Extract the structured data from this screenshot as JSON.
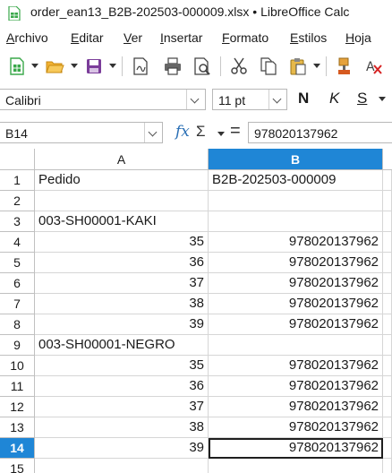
{
  "window": {
    "title": "order_ean13_B2B-202503-000009.xlsx • LibreOffice Calc"
  },
  "menu": {
    "items": [
      {
        "label": "Archivo",
        "u": "A",
        "rest": "rchivo"
      },
      {
        "label": "Editar",
        "u": "E",
        "rest": "ditar"
      },
      {
        "label": "Ver",
        "u": "V",
        "rest": "er"
      },
      {
        "label": "Insertar",
        "u": "I",
        "rest": "nsertar"
      },
      {
        "label": "Formato",
        "u": "F",
        "rest": "ormato"
      },
      {
        "label": "Estilos",
        "u": "E",
        "rest": "stilos"
      },
      {
        "label": "Hoja",
        "u": "H",
        "rest": "oja"
      }
    ]
  },
  "toolbar": {
    "icons": [
      "new-spreadsheet-icon",
      "open-folder-icon",
      "save-icon",
      "export-pdf-icon",
      "print-icon",
      "print-preview-icon",
      "cut-icon",
      "copy-icon",
      "paste-icon",
      "clone-formatting-icon",
      "clear-formatting-icon"
    ]
  },
  "format": {
    "font_name": "Calibri",
    "font_size": "11 pt",
    "bold": "N",
    "italic": "K",
    "underline": "S"
  },
  "formula_bar": {
    "name_box": "B14",
    "fx": "fx",
    "sum": "Σ",
    "equals": "=",
    "content": "978020137962"
  },
  "sheet": {
    "columns": [
      "A",
      "B"
    ],
    "selected_column": "B",
    "active_cell": "B14",
    "rows": [
      {
        "num": "1",
        "a": "Pedido",
        "b": "B2B-202503-000009",
        "a_num": false,
        "b_num": false
      },
      {
        "num": "2",
        "a": "",
        "b": "",
        "a_num": false,
        "b_num": false
      },
      {
        "num": "3",
        "a": "003-SH00001-KAKI",
        "b": "",
        "a_num": false,
        "b_num": false
      },
      {
        "num": "4",
        "a": "35",
        "b": "978020137962",
        "a_num": true,
        "b_num": true
      },
      {
        "num": "5",
        "a": "36",
        "b": "978020137962",
        "a_num": true,
        "b_num": true
      },
      {
        "num": "6",
        "a": "37",
        "b": "978020137962",
        "a_num": true,
        "b_num": true
      },
      {
        "num": "7",
        "a": "38",
        "b": "978020137962",
        "a_num": true,
        "b_num": true
      },
      {
        "num": "8",
        "a": "39",
        "b": "978020137962",
        "a_num": true,
        "b_num": true
      },
      {
        "num": "9",
        "a": "003-SH00001-NEGRO",
        "b": "",
        "a_num": false,
        "b_num": false
      },
      {
        "num": "10",
        "a": "35",
        "b": "978020137962",
        "a_num": true,
        "b_num": true
      },
      {
        "num": "11",
        "a": "36",
        "b": "978020137962",
        "a_num": true,
        "b_num": true
      },
      {
        "num": "12",
        "a": "37",
        "b": "978020137962",
        "a_num": true,
        "b_num": true
      },
      {
        "num": "13",
        "a": "38",
        "b": "978020137962",
        "a_num": true,
        "b_num": true
      },
      {
        "num": "14",
        "a": "39",
        "b": "978020137962",
        "a_num": true,
        "b_num": true
      },
      {
        "num": "15",
        "a": "",
        "b": "",
        "a_num": false,
        "b_num": false
      }
    ]
  },
  "colors": {
    "selection": "#1f86d6",
    "grid": "#d6d6d6",
    "header_border": "#c0c0c0"
  }
}
